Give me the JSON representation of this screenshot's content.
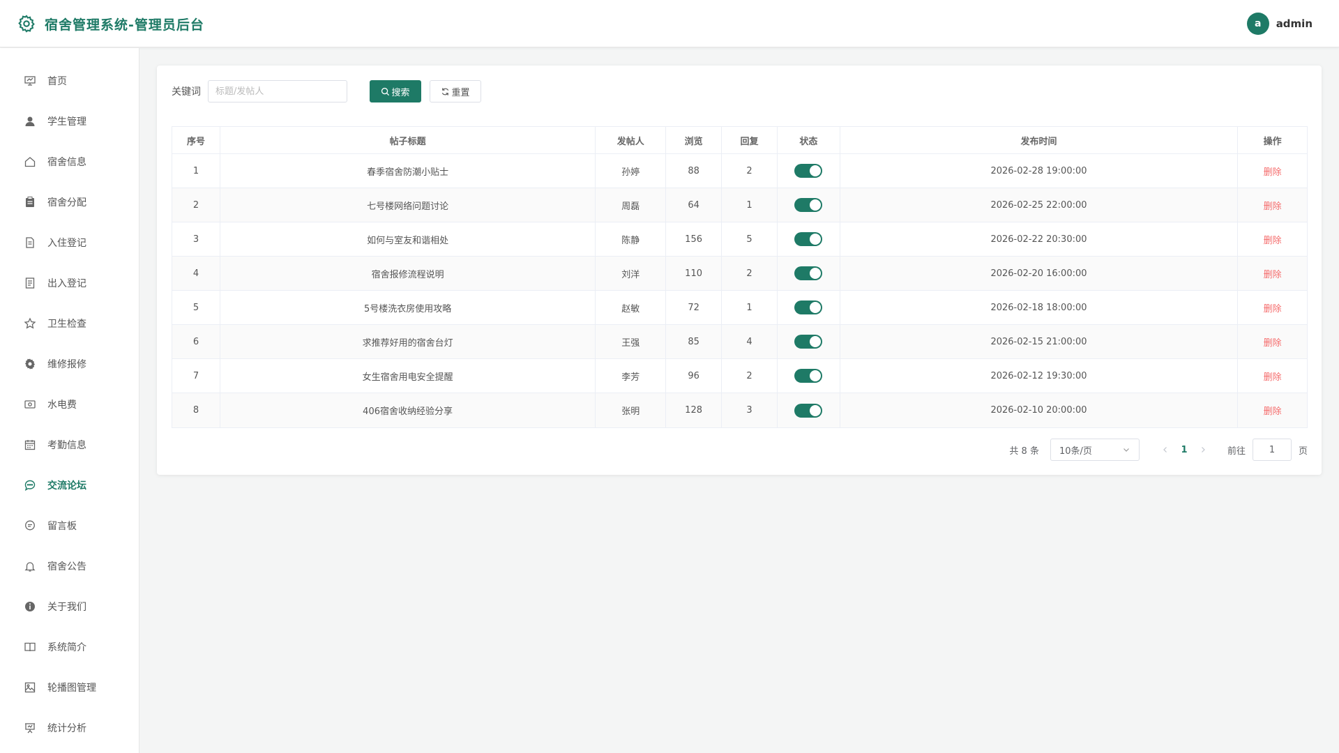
{
  "header": {
    "title": "宿舍管理系统-管理员后台",
    "avatar_letter": "a",
    "username": "admin"
  },
  "sidebar": {
    "items": [
      {
        "label": "首页",
        "icon": "chart-board-icon"
      },
      {
        "label": "学生管理",
        "icon": "user-icon"
      },
      {
        "label": "宿舍信息",
        "icon": "house-icon"
      },
      {
        "label": "宿舍分配",
        "icon": "clipboard-icon"
      },
      {
        "label": "入住登记",
        "icon": "document-icon"
      },
      {
        "label": "出入登记",
        "icon": "notes-icon"
      },
      {
        "label": "卫生检查",
        "icon": "star-icon"
      },
      {
        "label": "维修报修",
        "icon": "gear-icon"
      },
      {
        "label": "水电费",
        "icon": "money-icon"
      },
      {
        "label": "考勤信息",
        "icon": "calendar-icon"
      },
      {
        "label": "交流论坛",
        "icon": "chat-icon",
        "active": true
      },
      {
        "label": "留言板",
        "icon": "message-icon"
      },
      {
        "label": "宿舍公告",
        "icon": "bell-icon"
      },
      {
        "label": "关于我们",
        "icon": "info-icon"
      },
      {
        "label": "系统简介",
        "icon": "book-icon"
      },
      {
        "label": "轮播图管理",
        "icon": "picture-icon"
      },
      {
        "label": "统计分析",
        "icon": "presentation-icon"
      }
    ]
  },
  "search": {
    "keyword_label": "关键词",
    "placeholder": "标题/发帖人",
    "value": "",
    "search_label": "搜索",
    "reset_label": "重置"
  },
  "table": {
    "columns": [
      "序号",
      "帖子标题",
      "发帖人",
      "浏览",
      "回复",
      "状态",
      "发布时间",
      "操作"
    ],
    "rows": [
      {
        "index": "1",
        "title": "春季宿舍防潮小贴士",
        "author": "孙婷",
        "views": "88",
        "replies": "2",
        "status_on": true,
        "time": "2026-02-28 19:00:00",
        "action": "删除"
      },
      {
        "index": "2",
        "title": "七号楼网络问题讨论",
        "author": "周磊",
        "views": "64",
        "replies": "1",
        "status_on": true,
        "time": "2026-02-25 22:00:00",
        "action": "删除"
      },
      {
        "index": "3",
        "title": "如何与室友和谐相处",
        "author": "陈静",
        "views": "156",
        "replies": "5",
        "status_on": true,
        "time": "2026-02-22 20:30:00",
        "action": "删除"
      },
      {
        "index": "4",
        "title": "宿舍报修流程说明",
        "author": "刘洋",
        "views": "110",
        "replies": "2",
        "status_on": true,
        "time": "2026-02-20 16:00:00",
        "action": "删除"
      },
      {
        "index": "5",
        "title": "5号楼洗衣房使用攻略",
        "author": "赵敏",
        "views": "72",
        "replies": "1",
        "status_on": true,
        "time": "2026-02-18 18:00:00",
        "action": "删除"
      },
      {
        "index": "6",
        "title": "求推荐好用的宿舍台灯",
        "author": "王强",
        "views": "85",
        "replies": "4",
        "status_on": true,
        "time": "2026-02-15 21:00:00",
        "action": "删除"
      },
      {
        "index": "7",
        "title": "女生宿舍用电安全提醒",
        "author": "李芳",
        "views": "96",
        "replies": "2",
        "status_on": true,
        "time": "2026-02-12 19:30:00",
        "action": "删除"
      },
      {
        "index": "8",
        "title": "406宿舍收纳经验分享",
        "author": "张明",
        "views": "128",
        "replies": "3",
        "status_on": true,
        "time": "2026-02-10 20:00:00",
        "action": "删除"
      }
    ]
  },
  "pagination": {
    "total_text": "共 8 条",
    "page_size": "10条/页",
    "current_page": "1",
    "goto_label": "前往",
    "goto_value": "1",
    "page_suffix": "页"
  },
  "colors": {
    "accent": "#1e7a66",
    "danger": "#f56c6c"
  }
}
